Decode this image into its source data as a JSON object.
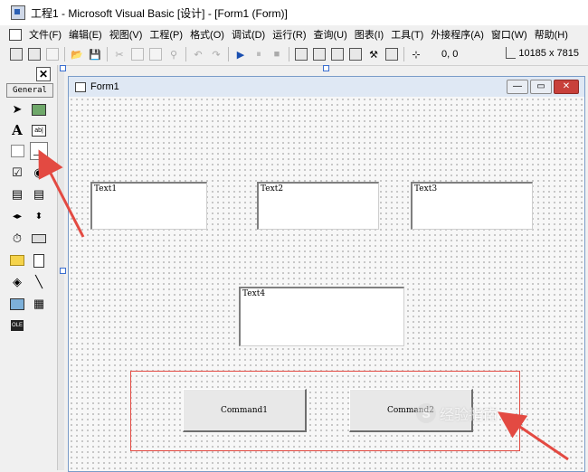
{
  "app": {
    "title": "工程1 - Microsoft Visual Basic [设计] - [Form1 (Form)]",
    "icon": "vb-project-icon"
  },
  "menu": {
    "items": [
      "文件(F)",
      "编辑(E)",
      "视图(V)",
      "工程(P)",
      "格式(O)",
      "调试(D)",
      "运行(R)",
      "查询(U)",
      "图表(I)",
      "工具(T)",
      "外接程序(A)",
      "窗口(W)",
      "帮助(H)"
    ]
  },
  "toolbar": {
    "position": "0, 0",
    "size": "10185 x 7815"
  },
  "toolbox": {
    "close_label": "✕",
    "general_label": "General"
  },
  "form": {
    "caption": "Form1",
    "textboxes": [
      "Text1",
      "Text2",
      "Text3",
      "Text4"
    ],
    "buttons": [
      "Command1",
      "Command2"
    ]
  },
  "watermark": {
    "glyph": "S",
    "text": "经验指南"
  },
  "colors": {
    "highlight_box": "#e34a42",
    "arrow": "#e34a42",
    "form_border": "#7a9cc9"
  }
}
